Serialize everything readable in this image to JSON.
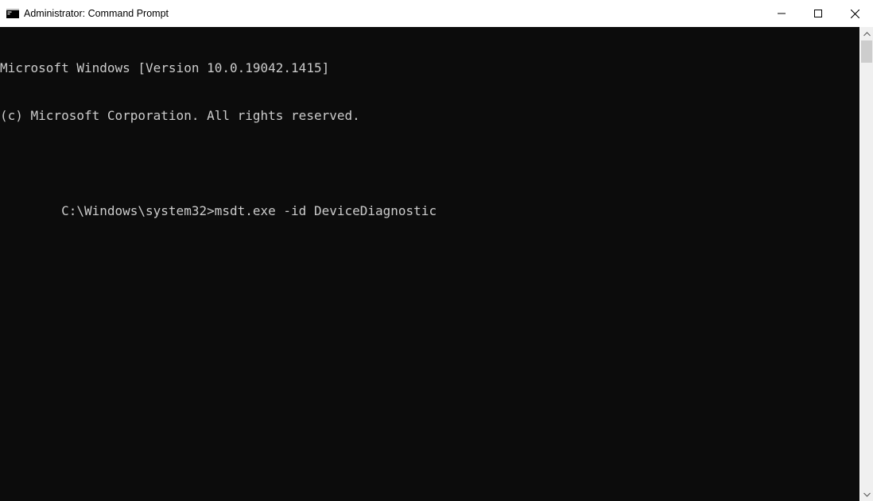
{
  "window": {
    "title": "Administrator: Command Prompt"
  },
  "terminal": {
    "line1": "Microsoft Windows [Version 10.0.19042.1415]",
    "line2": "(c) Microsoft Corporation. All rights reserved.",
    "blank": "",
    "prompt": "C:\\Windows\\system32>",
    "command": "msdt.exe -id DeviceDiagnostic"
  }
}
